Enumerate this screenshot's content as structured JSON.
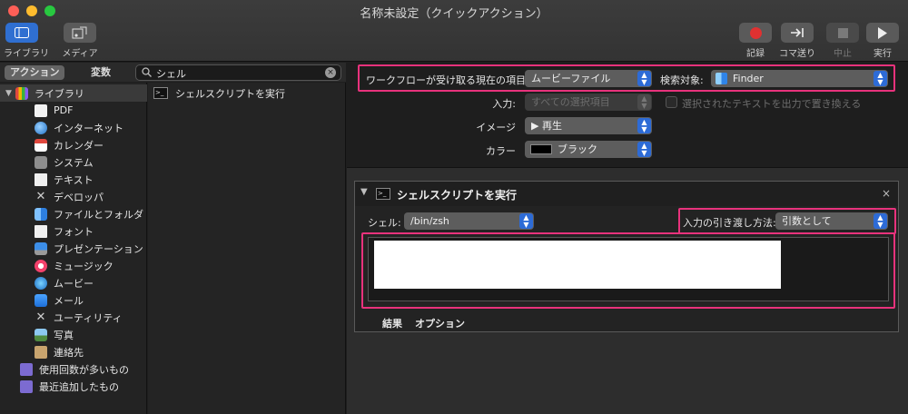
{
  "window": {
    "title": "名称未設定（クイックアクション）"
  },
  "toolbar": {
    "library_label": "ライブラリ",
    "media_label": "メディア",
    "record_label": "記録",
    "step_label": "コマ送り",
    "stop_label": "中止",
    "run_label": "実行"
  },
  "left": {
    "tab_actions": "アクション",
    "tab_variables": "変数",
    "search_value": "シェル",
    "library": {
      "root": "ライブラリ",
      "items": [
        "PDF",
        "インターネット",
        "カレンダー",
        "システム",
        "テキスト",
        "デベロッパ",
        "ファイルとフォルダ",
        "フォント",
        "プレゼンテーション",
        "ミュージック",
        "ムービー",
        "メール",
        "ユーティリティ",
        "写真",
        "連絡先"
      ],
      "smart": [
        "使用回数が多いもの",
        "最近追加したもの"
      ]
    },
    "results": [
      "シェルスクリプトを実行"
    ]
  },
  "workflow": {
    "receives_label": "ワークフローが受け取る現在の項目:",
    "receives_value": "ムービーファイル",
    "search_in_label": "検索対象:",
    "search_in_value": "Finder",
    "input_label": "入力:",
    "input_value": "すべての選択項目",
    "replace_label": "選択されたテキストを出力で置き換える",
    "image_label": "イメージ",
    "image_value": "▶ 再生",
    "color_label": "カラー",
    "color_value": "ブラック"
  },
  "action": {
    "title": "シェルスクリプトを実行",
    "shell_label": "シェル:",
    "shell_value": "/bin/zsh",
    "pass_input_label": "入力の引き渡し方法:",
    "pass_input_value": "引数として",
    "tab_results": "結果",
    "tab_options": "オプション"
  },
  "colors": {
    "highlight": "#e8327c",
    "accent": "#2d6bd6"
  }
}
